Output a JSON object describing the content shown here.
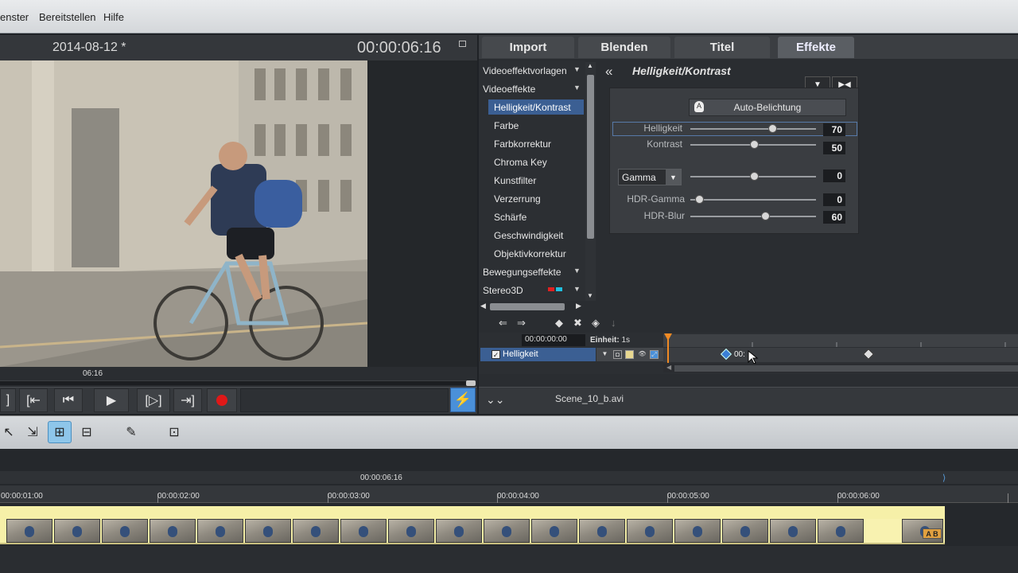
{
  "menu": {
    "items": [
      "enster",
      "Bereitstellen",
      "Hilfe"
    ]
  },
  "preview": {
    "title": "2014-08-12 *",
    "timecode": "00:00:06:16",
    "scrub_time": "06:16"
  },
  "tabs": [
    {
      "label": "Import",
      "active": false
    },
    {
      "label": "Blenden",
      "active": false
    },
    {
      "label": "Titel",
      "active": false
    },
    {
      "label": "Effekte",
      "active": true
    }
  ],
  "fx_list": {
    "categories": {
      "videoeffektvorlagen": "Videoeffektvorlagen",
      "videoeffekte": "Videoeffekte",
      "bewegungseffekte": "Bewegungseffekte",
      "stereo3d": "Stereo3D"
    },
    "subitems": [
      "Helligkeit/Kontrast",
      "Farbe",
      "Farbkorrektur",
      "Chroma Key",
      "Kunstfilter",
      "Verzerrung",
      "Schärfe",
      "Geschwindigkeit",
      "Objektivkorrektur"
    ],
    "selected": "Helligkeit/Kontrast"
  },
  "effect": {
    "title": "Helligkeit/Kontrast",
    "auto_button": "Auto-Belichtung",
    "params": {
      "helligkeit": {
        "label": "Helligkeit",
        "value": "70",
        "fraction": 0.67
      },
      "kontrast": {
        "label": "Kontrast",
        "value": "50",
        "fraction": 0.5
      },
      "gamma": {
        "label": "Gamma",
        "value": "0",
        "fraction": 0.5
      },
      "hdr_gamma": {
        "label": "HDR-Gamma",
        "value": "0",
        "fraction": 0.0
      },
      "hdr_blur": {
        "label": "HDR-Blur",
        "value": "60",
        "fraction": 0.6
      }
    }
  },
  "keyframes": {
    "time": "00:00:00:00",
    "unit_label": "Einheit:",
    "unit_value": "1s",
    "track_label": "Helligkeit",
    "kf1_text": "00:"
  },
  "bottom": {
    "filename": "Scene_10_b.avi"
  },
  "timeline": {
    "cursor_time": "00:00:06:16",
    "ruler": [
      "00:00:01:00",
      "00:00:02:00",
      "00:00:03:00",
      "00:00:04:00",
      "00:00:05:00",
      "00:00:06:00"
    ],
    "ab_badge": "A B"
  },
  "colors": {
    "accent": "#3b5f93",
    "playhead": "#f08a24",
    "clip": "#f6f0a8"
  }
}
